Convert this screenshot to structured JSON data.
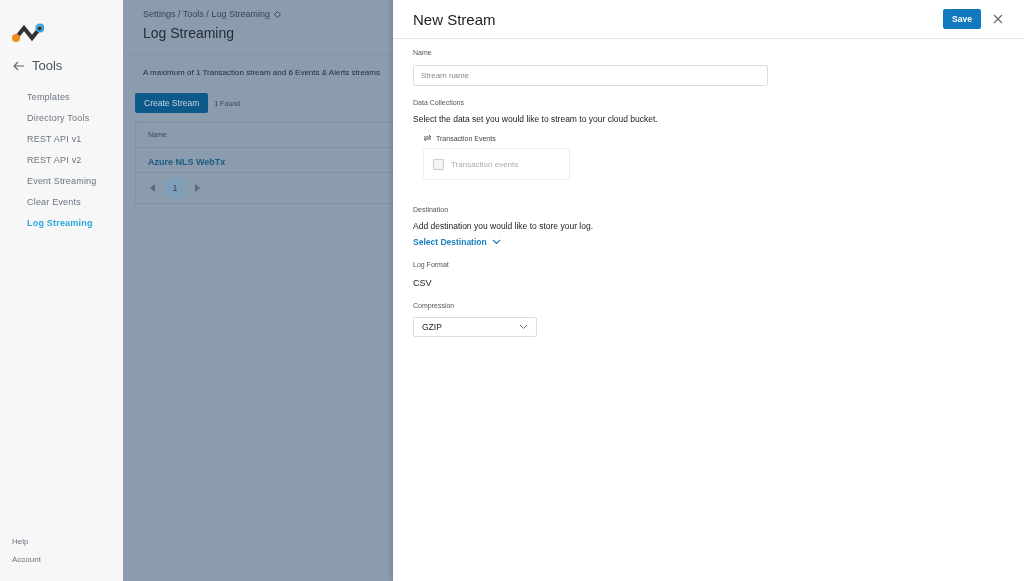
{
  "sidebar": {
    "back_label": "Tools",
    "items": [
      {
        "label": "Templates",
        "selected": false
      },
      {
        "label": "Directory Tools",
        "selected": false
      },
      {
        "label": "REST API v1",
        "selected": false
      },
      {
        "label": "REST API v2",
        "selected": false
      },
      {
        "label": "Event Streaming",
        "selected": false
      },
      {
        "label": "Clear Events",
        "selected": false
      },
      {
        "label": "Log Streaming",
        "selected": true
      }
    ],
    "footer": [
      "Help",
      "Account"
    ]
  },
  "page": {
    "breadcrumb": "Settings / Tools / Log Streaming",
    "title": "Log Streaming",
    "notice": "A maximum of 1 Transaction stream and 6 Events & Alerts streams",
    "create_button": "Create Stream",
    "found": "1 Found",
    "table": {
      "columns": [
        "Name"
      ],
      "rows": [
        "Azure NLS WebTx"
      ]
    },
    "pagination": {
      "pages": [
        {
          "label": "1",
          "selected": true
        }
      ]
    }
  },
  "drawer": {
    "title": "New Stream",
    "save": "Save",
    "name": {
      "label": "Name",
      "placeholder": "Stream name"
    },
    "data_collections": {
      "label": "Data Collections",
      "description": "Select the data set you would like to stream to your cloud bucket.",
      "group": "Transaction Events",
      "option": {
        "label": "Transaction events",
        "checked": false,
        "disabled": true
      }
    },
    "destination": {
      "label": "Destination",
      "description": "Add destination you would like to store your log.",
      "select": "Select Destination"
    },
    "log_format": {
      "label": "Log Format",
      "value": "CSV"
    },
    "compression": {
      "label": "Compression",
      "value": "GZIP"
    }
  }
}
